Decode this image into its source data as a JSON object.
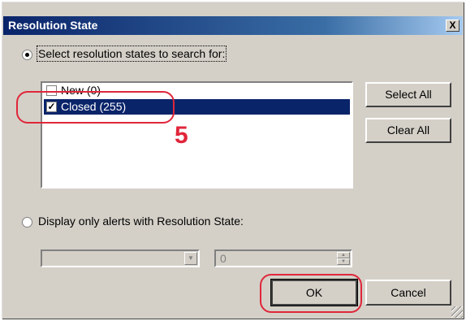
{
  "dialog": {
    "title": "Resolution State",
    "close_glyph": "X"
  },
  "search_option": {
    "label": "Select resolution states to search for:",
    "selected": true
  },
  "states": [
    {
      "label": "New (0)",
      "checked": false,
      "selected": false
    },
    {
      "label": "Closed (255)",
      "checked": true,
      "selected": true
    }
  ],
  "buttons": {
    "select_all": "Select All",
    "clear_all": "Clear All",
    "ok": "OK",
    "cancel": "Cancel"
  },
  "display_option": {
    "label": "Display only alerts with Resolution State:",
    "selected": false
  },
  "state_dropdown": {
    "value": ""
  },
  "state_value": {
    "value": "0"
  },
  "annotation": {
    "number": "5",
    "color": "#e0263a"
  }
}
